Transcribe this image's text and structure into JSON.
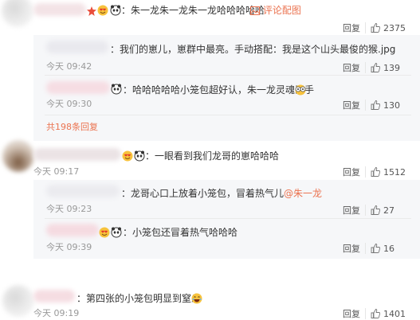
{
  "comments": [
    {
      "text": "：朱一龙朱一龙朱一龙哈哈哈哈哈",
      "attachment_label": "评论配图",
      "actions": {
        "reply": "回复",
        "likes": "2375"
      },
      "replies": [
        {
          "text": "：我们的崽儿，崽群中最亮。手动搭配：我是这个山头最俊的猴.jpg",
          "time": "今天 09:42",
          "actions": {
            "reply": "回复",
            "likes": "139"
          }
        },
        {
          "text": "：哈哈哈哈哈小笼包超好认，朱一龙灵魂画手",
          "time": "今天 09:30",
          "actions": {
            "reply": "回复",
            "likes": "130"
          }
        }
      ],
      "more_replies": "共198条回复"
    },
    {
      "text": "：一眼看到我们龙哥的崽哈哈哈",
      "time": "今天 09:17",
      "actions": {
        "reply": "回复",
        "likes": "1512"
      },
      "replies": [
        {
          "text": "：龙哥心口上放着小笼包，冒着热气儿",
          "mention": "@朱一龙",
          "time": "今天 09:23",
          "actions": {
            "reply": "回复",
            "likes": "27"
          }
        },
        {
          "text": "：小笼包还冒着热气哈哈哈",
          "time": "今天 09:39",
          "actions": {
            "reply": "回复",
            "likes": "16"
          }
        }
      ]
    },
    {
      "text": "：第四张的小笼包明显到窒息",
      "time": "今天 09:19",
      "actions": {
        "reply": "回复",
        "likes": "1401"
      }
    }
  ],
  "colors": {
    "link": "#eb7350",
    "reply_bg": "#f6f7f9",
    "time": "#999999"
  }
}
